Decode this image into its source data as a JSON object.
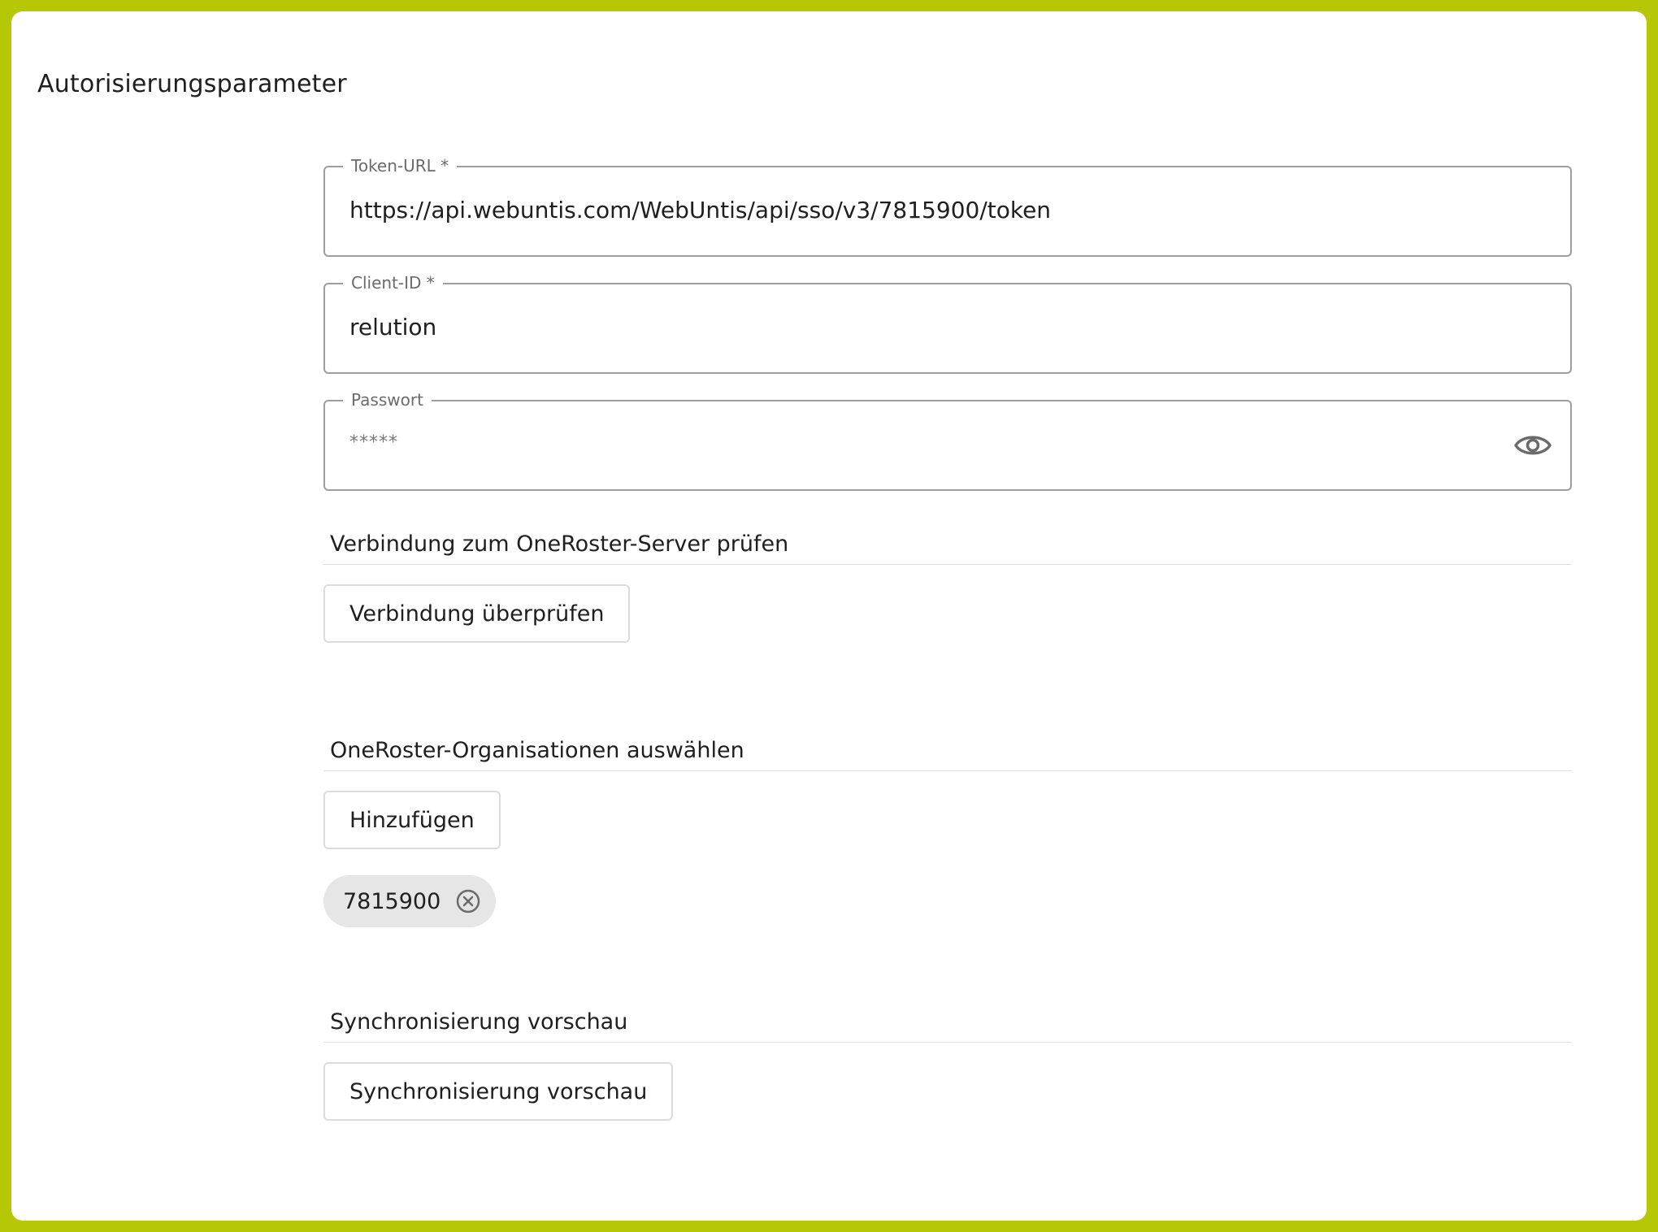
{
  "section": {
    "title": "Autorisierungsparameter"
  },
  "fields": {
    "token_url": {
      "label": "Token-URL *",
      "value": "https://api.webuntis.com/WebUntis/api/sso/v3/7815900/token"
    },
    "client_id": {
      "label": "Client-ID *",
      "value": "relution"
    },
    "password": {
      "label": "Passwort",
      "value": "*****",
      "icon": "eye-icon"
    }
  },
  "connection": {
    "heading": "Verbindung zum OneRoster-Server prüfen",
    "button_label": "Verbindung überprüfen"
  },
  "organizations": {
    "heading": "OneRoster-Organisationen auswählen",
    "add_button_label": "Hinzufügen",
    "chips": [
      {
        "label": "7815900",
        "icon": "close-circle-icon"
      }
    ]
  },
  "sync_preview": {
    "heading": "Synchronisierung vorschau",
    "button_label": "Synchronisierung vorschau"
  },
  "colors": {
    "frame_border": "#b6c708",
    "background": "#ffffff",
    "field_border": "#9e9e9e",
    "chip_background": "#e6e6e6"
  }
}
